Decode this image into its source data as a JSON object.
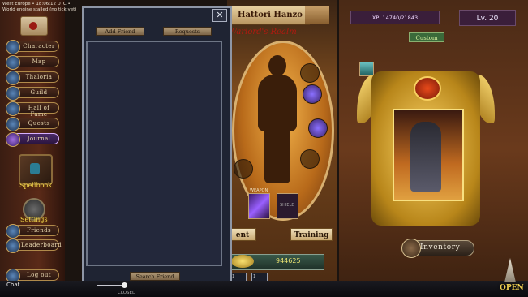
{
  "status": {
    "line1": "West Europe  •  18:06:12 UTC  •",
    "line2": "World engine stalled (no tick yet)"
  },
  "nav": {
    "items": [
      {
        "label": "Character",
        "icon": "helmet-icon",
        "active": false
      },
      {
        "label": "Map",
        "icon": "map-icon",
        "active": false
      },
      {
        "label": "Thaloria",
        "icon": "tower-icon",
        "active": false
      },
      {
        "label": "Guild",
        "icon": "banner-icon",
        "active": false
      },
      {
        "label": "Hall of Fame",
        "icon": "trophy-icon",
        "active": false
      },
      {
        "label": "Quests",
        "icon": "scroll-icon",
        "active": false
      },
      {
        "label": "Journal",
        "icon": "gem-icon",
        "active": true
      }
    ],
    "spellbook_label": "Spellbook",
    "settings_label": "Settings",
    "friends_label": "Friends",
    "leaderboard_label": "Leaderboard",
    "logout_label": "Log out"
  },
  "friends": {
    "add_friend": "Add Friend",
    "requests": "Requests",
    "search_friend": "Search Friend",
    "close": "✕"
  },
  "character": {
    "name": "Hattori Hanzo",
    "realm": "Warlord's Realm",
    "equipment_button": "ent",
    "training_button": "Training",
    "weapon_label": "WEAPON",
    "shield_label": "SHIELD",
    "gold": "944625",
    "slot1": "1",
    "slot2": "1"
  },
  "profile": {
    "xp": "XP: 14740/21843",
    "level": "Lv. 20",
    "custom_label": "Custom",
    "inventory_label": "Inventory",
    "open_label": "OPEN"
  },
  "chat": {
    "label": "Chat",
    "state": "CLOSED"
  },
  "colors": {
    "gold_accent": "#f0d050",
    "realm_red": "#b01a10",
    "journal_purple": "#4a2a66",
    "friends_panel": "#1f2433"
  }
}
